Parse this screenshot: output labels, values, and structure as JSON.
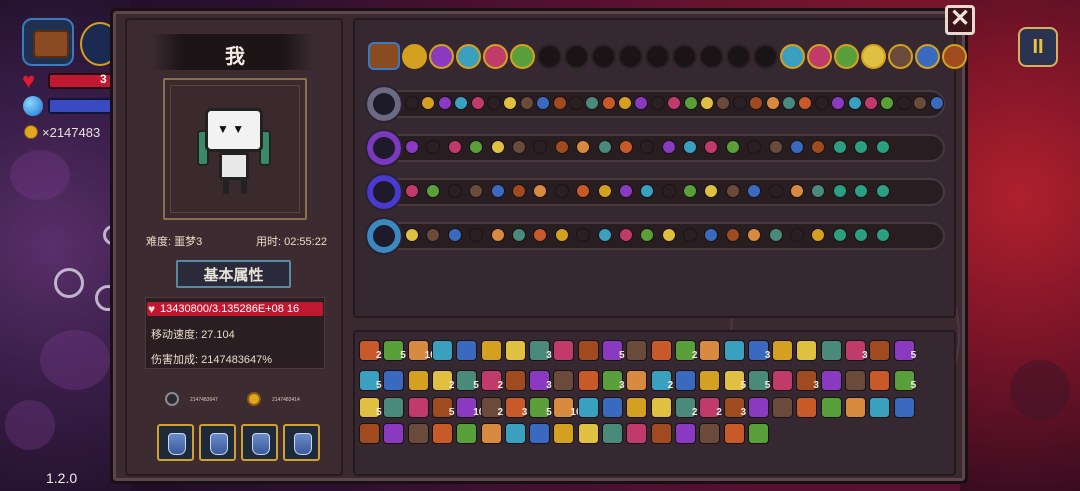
{
  "hud": {
    "hp_text": "3",
    "gold": "×2147483",
    "version": "1.2.0",
    "pause_label": "II"
  },
  "close_label": "✕",
  "player": {
    "name": "我",
    "difficulty": "难度: 噩梦3",
    "time": "用时: 02:55:22",
    "face": "▼ ▼"
  },
  "stats": {
    "title": "基本属性",
    "hp": "13430800/3.135286E+08 16",
    "move_speed": "移动速度: 27.104",
    "damage_bonus": "伤害加成: 2147483647%"
  },
  "currency": {
    "keys": "2147483647",
    "coins": "2147483414"
  },
  "potions": [
    1,
    2,
    3,
    4
  ],
  "item_counts": {
    "row1": [
      "2",
      "5",
      "10",
      "3",
      "5",
      "2",
      "3",
      "3",
      "5"
    ],
    "row2": [
      "5",
      "2",
      "5",
      "2",
      "3",
      "3",
      "2",
      "5",
      "5",
      "3",
      "5"
    ],
    "row3": [
      "5",
      "5",
      "10",
      "2",
      "3",
      "5",
      "104",
      "2",
      "2",
      "3"
    ]
  },
  "colors": {
    "accent_gold": "#d4a020",
    "hp_red": "#c01830",
    "mana_blue": "#3a4ac0",
    "panel": "#3a2a30"
  }
}
